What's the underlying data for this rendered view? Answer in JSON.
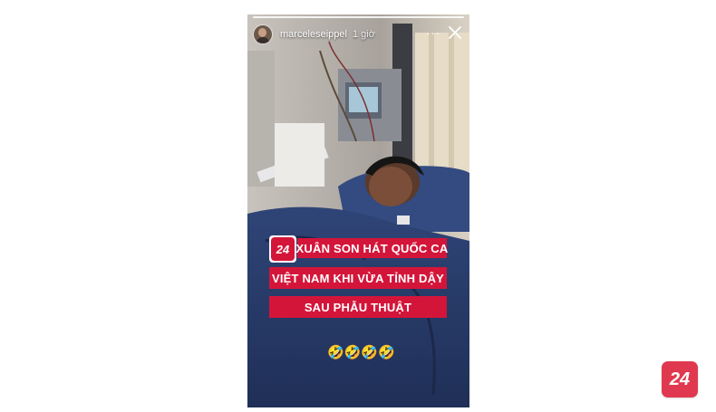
{
  "story": {
    "username": "marceleseippel",
    "time_ago": "1 giờ",
    "more_label": "···",
    "logo_text": "24",
    "caption_lines": [
      "XUÂN SON HÁT QUỐC CA",
      "VIỆT NAM KHI VỪA TỈNH DẬY",
      "SAU PHẪU THUẬT"
    ],
    "emojis": "🤣🤣🤣🤣"
  },
  "corner_logo": {
    "text": "24"
  },
  "colors": {
    "brand_red": "#d4153a",
    "corner_red": "#e0394f"
  },
  "icons": [
    "avatar",
    "more-icon",
    "close-icon",
    "brand-24-logo"
  ]
}
